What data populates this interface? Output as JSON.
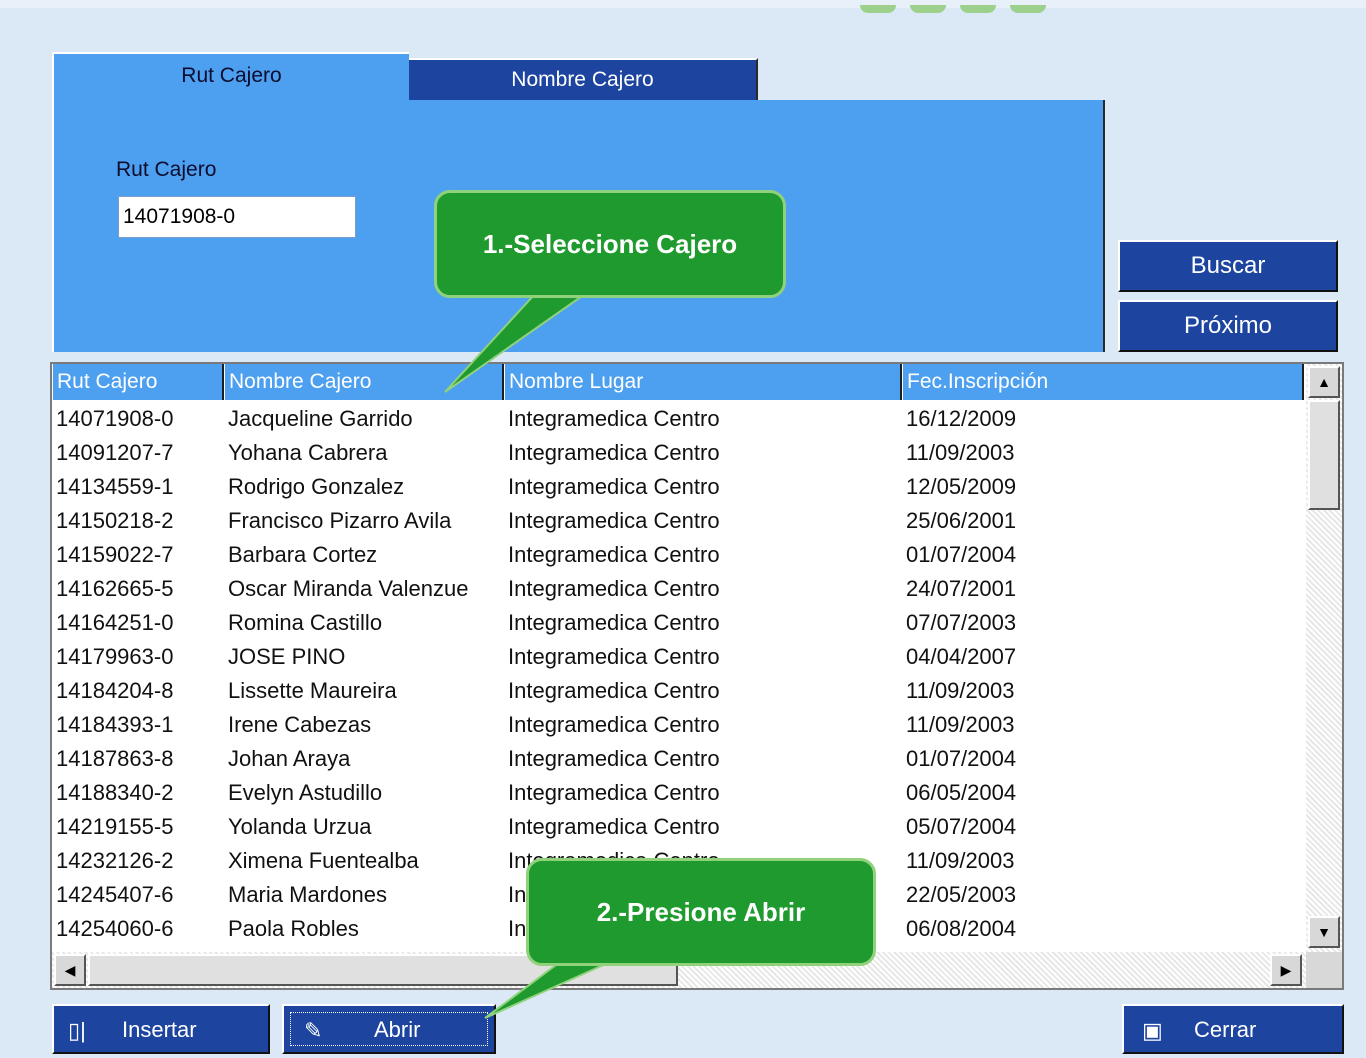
{
  "tabs": [
    {
      "label": "Rut Cajero",
      "active": true
    },
    {
      "label": "Nombre Cajero",
      "active": false
    }
  ],
  "search": {
    "label": "Rut Cajero",
    "value": "14071908-0"
  },
  "buttons": {
    "buscar": "Buscar",
    "proximo": "Próximo",
    "insertar": "Insertar",
    "abrir": "Abrir",
    "cerrar": "Cerrar"
  },
  "grid": {
    "headers": [
      "Rut Cajero",
      "Nombre Cajero",
      "Nombre Lugar",
      "Fec.Inscripción"
    ],
    "rows": [
      [
        "14071908-0",
        "Jacqueline Garrido",
        "Integramedica Centro",
        "16/12/2009"
      ],
      [
        "14091207-7",
        "Yohana Cabrera",
        "Integramedica Centro",
        "11/09/2003"
      ],
      [
        "14134559-1",
        "Rodrigo Gonzalez",
        "Integramedica Centro",
        "12/05/2009"
      ],
      [
        "14150218-2",
        "Francisco Pizarro Avila",
        "Integramedica Centro",
        "25/06/2001"
      ],
      [
        "14159022-7",
        "Barbara Cortez",
        "Integramedica Centro",
        "01/07/2004"
      ],
      [
        "14162665-5",
        "Oscar Miranda Valenzue",
        "Integramedica Centro",
        "24/07/2001"
      ],
      [
        "14164251-0",
        "Romina Castillo",
        "Integramedica Centro",
        "07/07/2003"
      ],
      [
        "14179963-0",
        "JOSE PINO",
        "Integramedica Centro",
        "04/04/2007"
      ],
      [
        "14184204-8",
        "Lissette Maureira",
        "Integramedica Centro",
        "11/09/2003"
      ],
      [
        "14184393-1",
        "Irene Cabezas",
        "Integramedica Centro",
        "11/09/2003"
      ],
      [
        "14187863-8",
        "Johan Araya",
        "Integramedica Centro",
        "01/07/2004"
      ],
      [
        "14188340-2",
        "Evelyn Astudillo",
        "Integramedica Centro",
        "06/05/2004"
      ],
      [
        "14219155-5",
        "Yolanda Urzua",
        "Integramedica Centro",
        "05/07/2004"
      ],
      [
        "14232126-2",
        "Ximena Fuentealba",
        "Integramedica Centro",
        "11/09/2003"
      ],
      [
        "14245407-6",
        "Maria Mardones",
        "Integramedica Centro",
        "22/05/2003"
      ],
      [
        "14254060-6",
        "Paola Robles",
        "Integramedica Centro",
        "06/08/2004"
      ]
    ]
  },
  "callouts": {
    "step1": "1.-Seleccione Cajero",
    "step2": "2.-Presione Abrir"
  },
  "colors": {
    "panel": "#4d9ff0",
    "button": "#1d45a0",
    "callout": "#1f9a2e"
  }
}
